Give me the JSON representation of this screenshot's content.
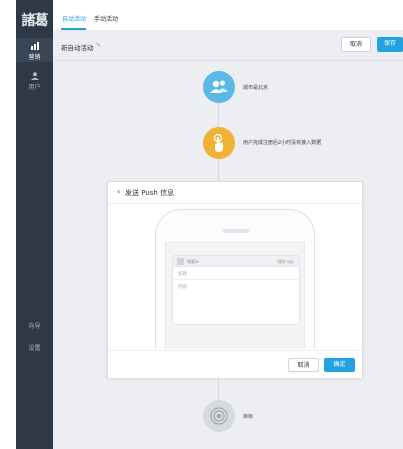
{
  "sidebar": {
    "logo": "諸葛",
    "items": [
      {
        "label": "营销",
        "icon": "bar-chart-icon",
        "active": true
      },
      {
        "label": "用户",
        "icon": "user-icon",
        "active": false
      }
    ],
    "bottom_items": [
      {
        "label": "向导"
      },
      {
        "label": "设置"
      }
    ]
  },
  "tabs": [
    {
      "label": "自动活动",
      "active": true
    },
    {
      "label": "手动活动",
      "active": false
    }
  ],
  "toolbar": {
    "activity_name": "新自动活动",
    "cancel_label": "取消",
    "save_label": "保存"
  },
  "flow": {
    "nodes": [
      {
        "label": "城市是北京",
        "icon": "users-icon",
        "color": "#5bb8e8"
      },
      {
        "label": "用户完成注册后2小时没有接入数据",
        "icon": "touch-icon",
        "color": "#f0b233"
      },
      {
        "label": "目标",
        "icon": "target-icon",
        "color": "#d6d9de"
      }
    ]
  },
  "modal": {
    "title": "发送 Push 信息",
    "push_preview": {
      "app_name": "诸葛io",
      "time": "刚刚 ago",
      "title_placeholder": "标题",
      "content_placeholder": "内容"
    },
    "cancel_label": "取消",
    "confirm_label": "确定"
  },
  "colors": {
    "sidebar_bg": "#2e3847",
    "accent": "#22a2e0",
    "canvas_bg": "#eceef1"
  }
}
